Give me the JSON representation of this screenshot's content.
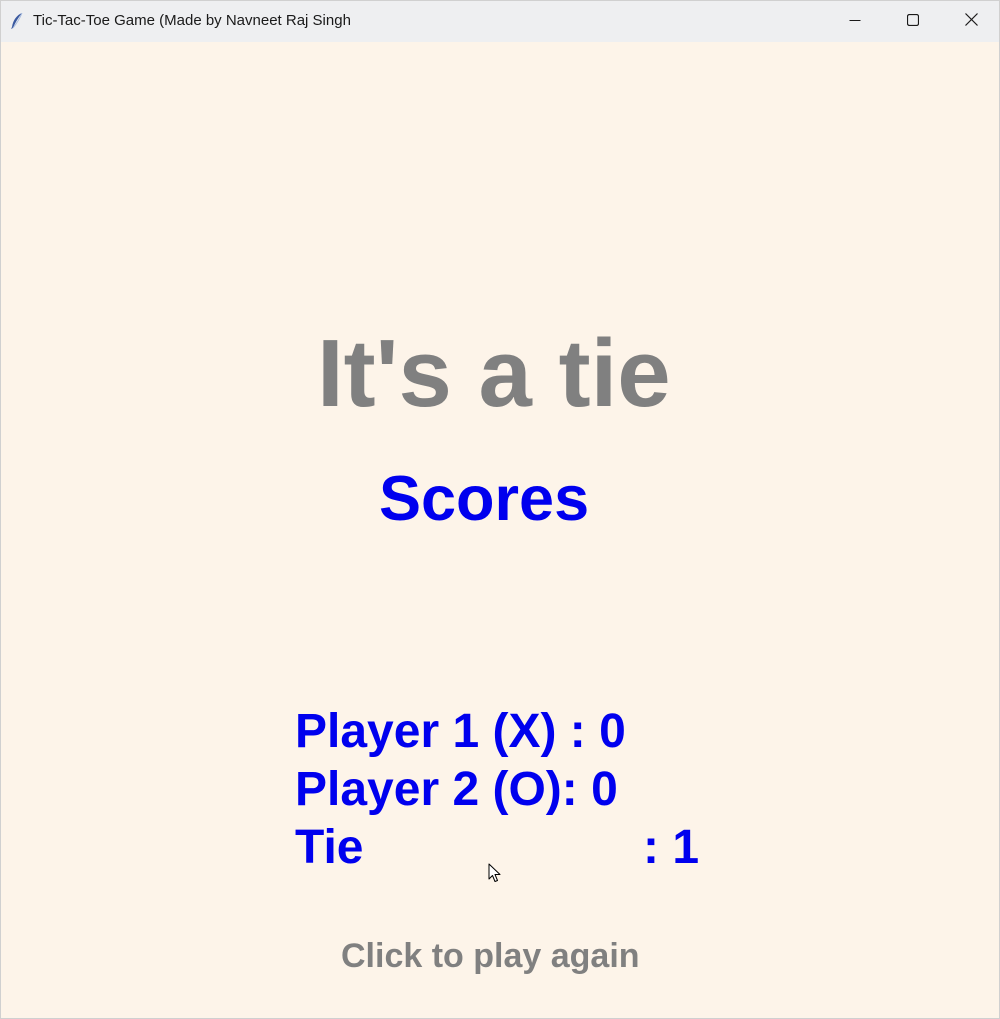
{
  "window": {
    "title": "Tic-Tac-Toe Game (Made by Navneet Raj Singh",
    "icon": "feather-icon",
    "controls": [
      "minimize-icon",
      "maximize-icon",
      "close-icon"
    ]
  },
  "game": {
    "result_text": "It's a tie",
    "scores_heading": "Scores",
    "player1_line": "Player 1 (X) : 0",
    "player2_line": "Player 2 (O): 0",
    "tie_label": "Tie",
    "tie_value": ": 1",
    "play_again": "Click to play again"
  },
  "colors": {
    "background": "#fdf4e9",
    "score_text": "#0000ee",
    "gray_text": "#808080",
    "titlebar": "#eeeff1"
  }
}
